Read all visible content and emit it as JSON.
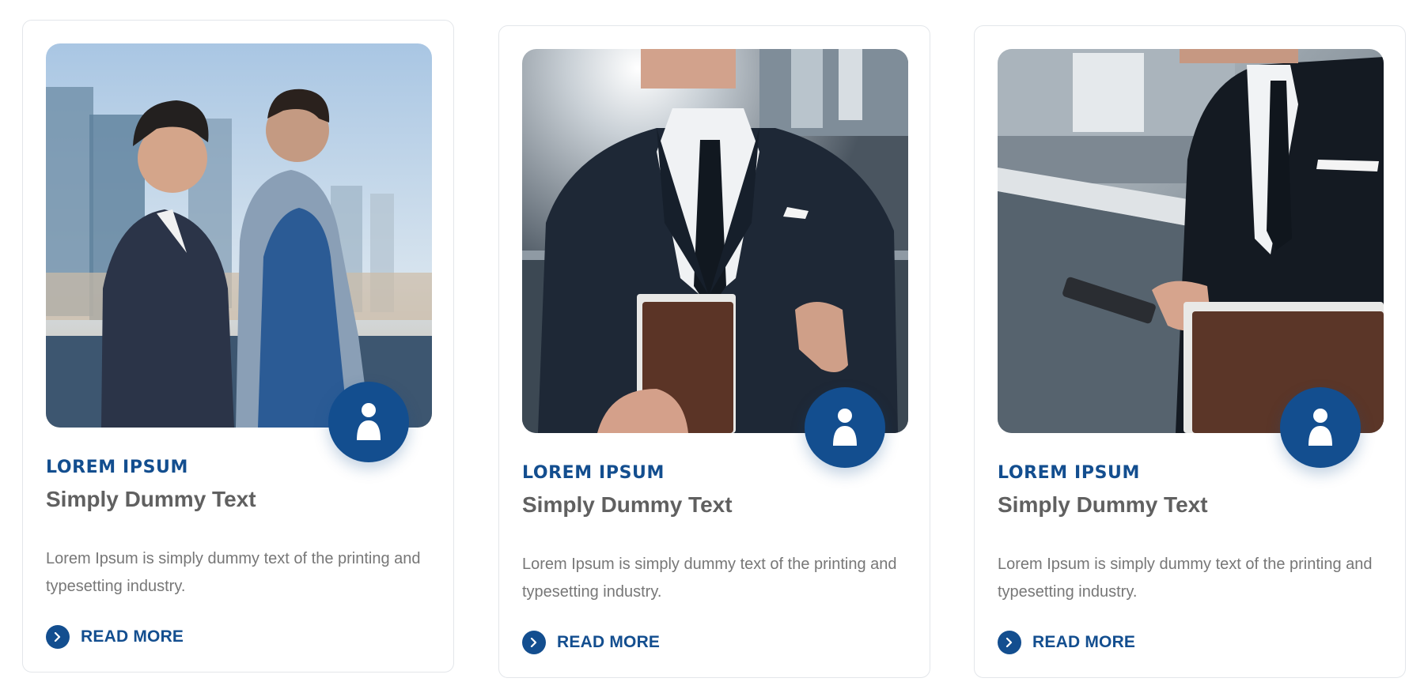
{
  "theme": {
    "accent": "#134e8f",
    "heading_text": "#606060",
    "body_text": "#777777",
    "card_border": "#e3e6ea"
  },
  "cards": [
    {
      "image": "photo of two businessmen in suits looking over a city skyline",
      "category": "LOREM IPSUM",
      "title": "Simply Dummy Text",
      "description": "Lorem Ipsum is simply dummy text of the printing and typesetting industry.",
      "cta": "READ MORE",
      "author_icon": "user-icon",
      "cta_icon": "chevron-right-icon"
    },
    {
      "image": "photo of a businessman in a dark suit holding a leather folder",
      "category": "LOREM IPSUM",
      "title": "Simply Dummy Text",
      "description": "Lorem Ipsum is simply dummy text of the printing and typesetting industry.",
      "cta": "READ MORE",
      "author_icon": "user-icon",
      "cta_icon": "chevron-right-icon"
    },
    {
      "image": "photo of a businessman holding a smartphone and a leather folder",
      "category": "LOREM IPSUM",
      "title": "Simply Dummy Text",
      "description": "Lorem Ipsum is simply dummy text of the printing and typesetting industry.",
      "cta": "READ MORE",
      "author_icon": "user-icon",
      "cta_icon": "chevron-right-icon"
    }
  ]
}
